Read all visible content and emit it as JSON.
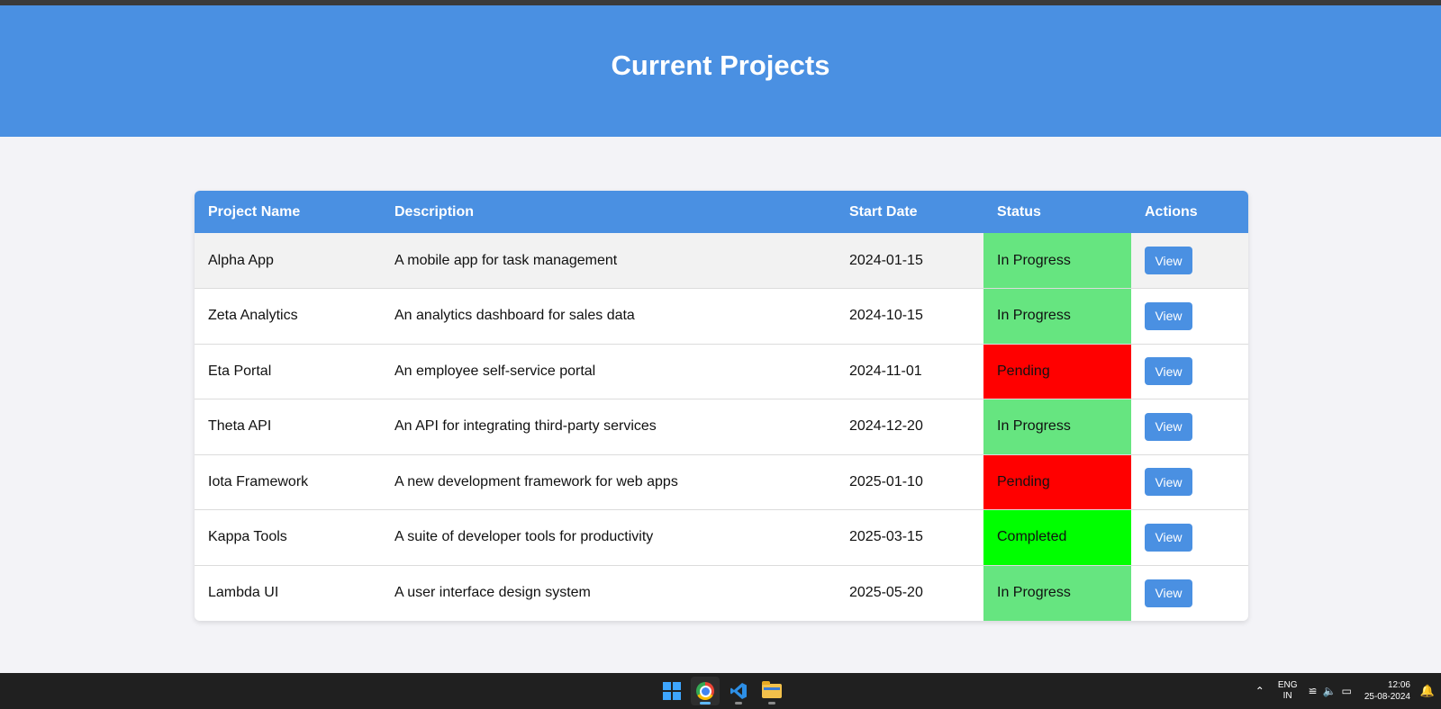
{
  "page": {
    "title": "Current Projects"
  },
  "table": {
    "columns": [
      "Project Name",
      "Description",
      "Start Date",
      "Status",
      "Actions"
    ],
    "rows": [
      {
        "name": "Alpha App",
        "description": "A mobile app for task management",
        "start_date": "2024-01-15",
        "status": "In Progress",
        "action": "View"
      },
      {
        "name": "Zeta Analytics",
        "description": "An analytics dashboard for sales data",
        "start_date": "2024-10-15",
        "status": "In Progress",
        "action": "View"
      },
      {
        "name": "Eta Portal",
        "description": "An employee self-service portal",
        "start_date": "2024-11-01",
        "status": "Pending",
        "action": "View"
      },
      {
        "name": "Theta API",
        "description": "An API for integrating third-party services",
        "start_date": "2024-12-20",
        "status": "In Progress",
        "action": "View"
      },
      {
        "name": "Iota Framework",
        "description": "A new development framework for web apps",
        "start_date": "2025-01-10",
        "status": "Pending",
        "action": "View"
      },
      {
        "name": "Kappa Tools",
        "description": "A suite of developer tools for productivity",
        "start_date": "2025-03-15",
        "status": "Completed",
        "action": "View"
      },
      {
        "name": "Lambda UI",
        "description": "A user interface design system",
        "start_date": "2025-05-20",
        "status": "In Progress",
        "action": "View"
      }
    ]
  },
  "status_colors": {
    "In Progress": "#66e580",
    "Pending": "#ff0000",
    "Completed": "#00ff00"
  },
  "colors": {
    "accent": "#4a90e2",
    "background": "#f3f3f7"
  },
  "taskbar": {
    "apps": [
      "windows-start-icon",
      "chrome-icon",
      "vscode-icon",
      "file-explorer-icon"
    ],
    "lang_top": "ENG",
    "lang_bottom": "IN",
    "time": "12:06",
    "date": "25-08-2024"
  }
}
